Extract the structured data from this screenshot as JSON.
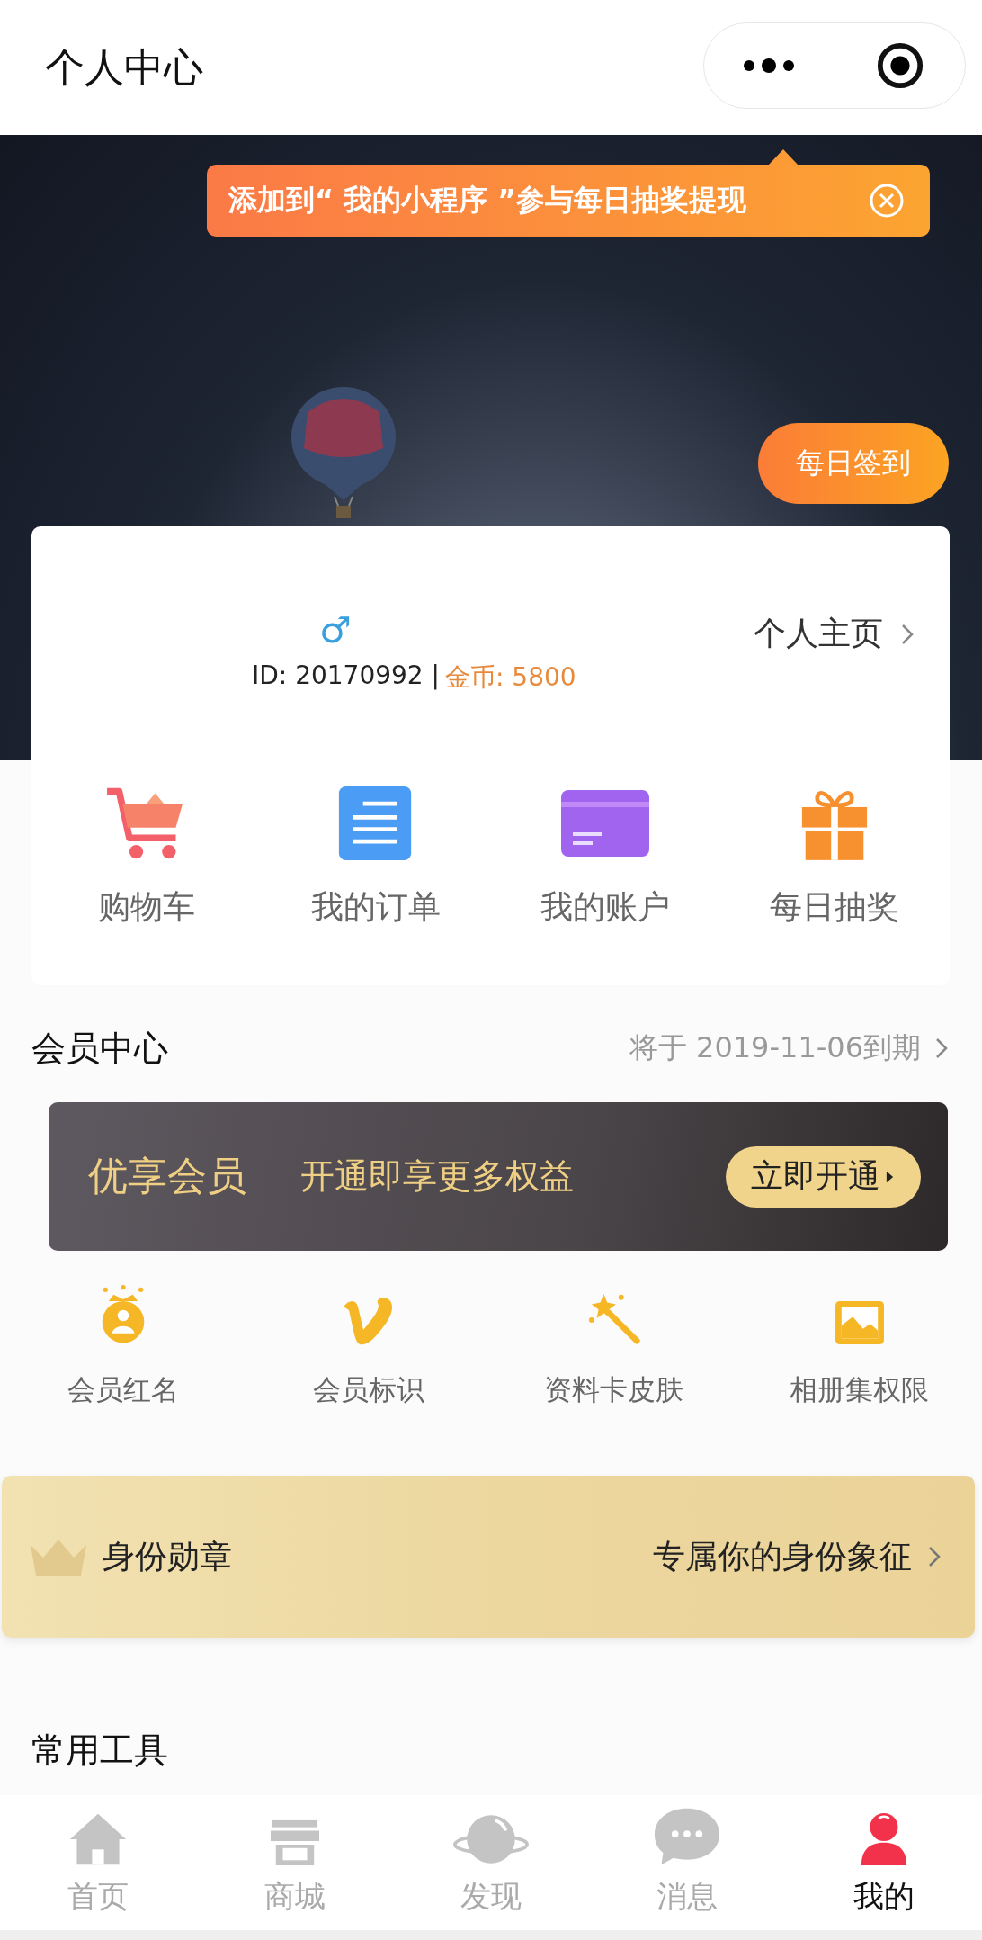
{
  "header": {
    "title": "个人中心"
  },
  "tooltip": {
    "text": "添加到“ 我的小程序 ”参与每日抽奖提现"
  },
  "checkin_button": "每日签到",
  "profile": {
    "gender": "♂",
    "id_text": "ID:  20170992 |",
    "coins": "金币:  5800",
    "homepage_link": "个人主页"
  },
  "quick_actions": [
    {
      "label": "购物车",
      "kind": "cart"
    },
    {
      "label": "我的订单",
      "kind": "document"
    },
    {
      "label": "我的账户",
      "kind": "card"
    },
    {
      "label": "每日抽奖",
      "kind": "gift"
    }
  ],
  "member_center": {
    "title": "会员中心",
    "expiry": "将于 2019-11-06到期",
    "banner": {
      "title": "优享会员",
      "slogan": "开通即享更多权益",
      "button": "立即开通"
    },
    "perks": [
      {
        "label": "会员红名",
        "kind": "crown-user"
      },
      {
        "label": "会员标识",
        "kind": "v-mark"
      },
      {
        "label": "资料卡皮肤",
        "kind": "wand"
      },
      {
        "label": "相册集权限",
        "kind": "picture"
      }
    ]
  },
  "badge_banner": {
    "title": "身份勋章",
    "subtitle": "专属你的身份象征"
  },
  "tools": {
    "title": "常用工具"
  },
  "tab_bar": [
    {
      "label": "首页",
      "kind": "home",
      "selected": false
    },
    {
      "label": "商城",
      "kind": "store",
      "selected": false
    },
    {
      "label": "发现",
      "kind": "planet",
      "selected": false
    },
    {
      "label": "消息",
      "kind": "chat",
      "selected": false
    },
    {
      "label": "我的",
      "kind": "person",
      "selected": true
    }
  ]
}
